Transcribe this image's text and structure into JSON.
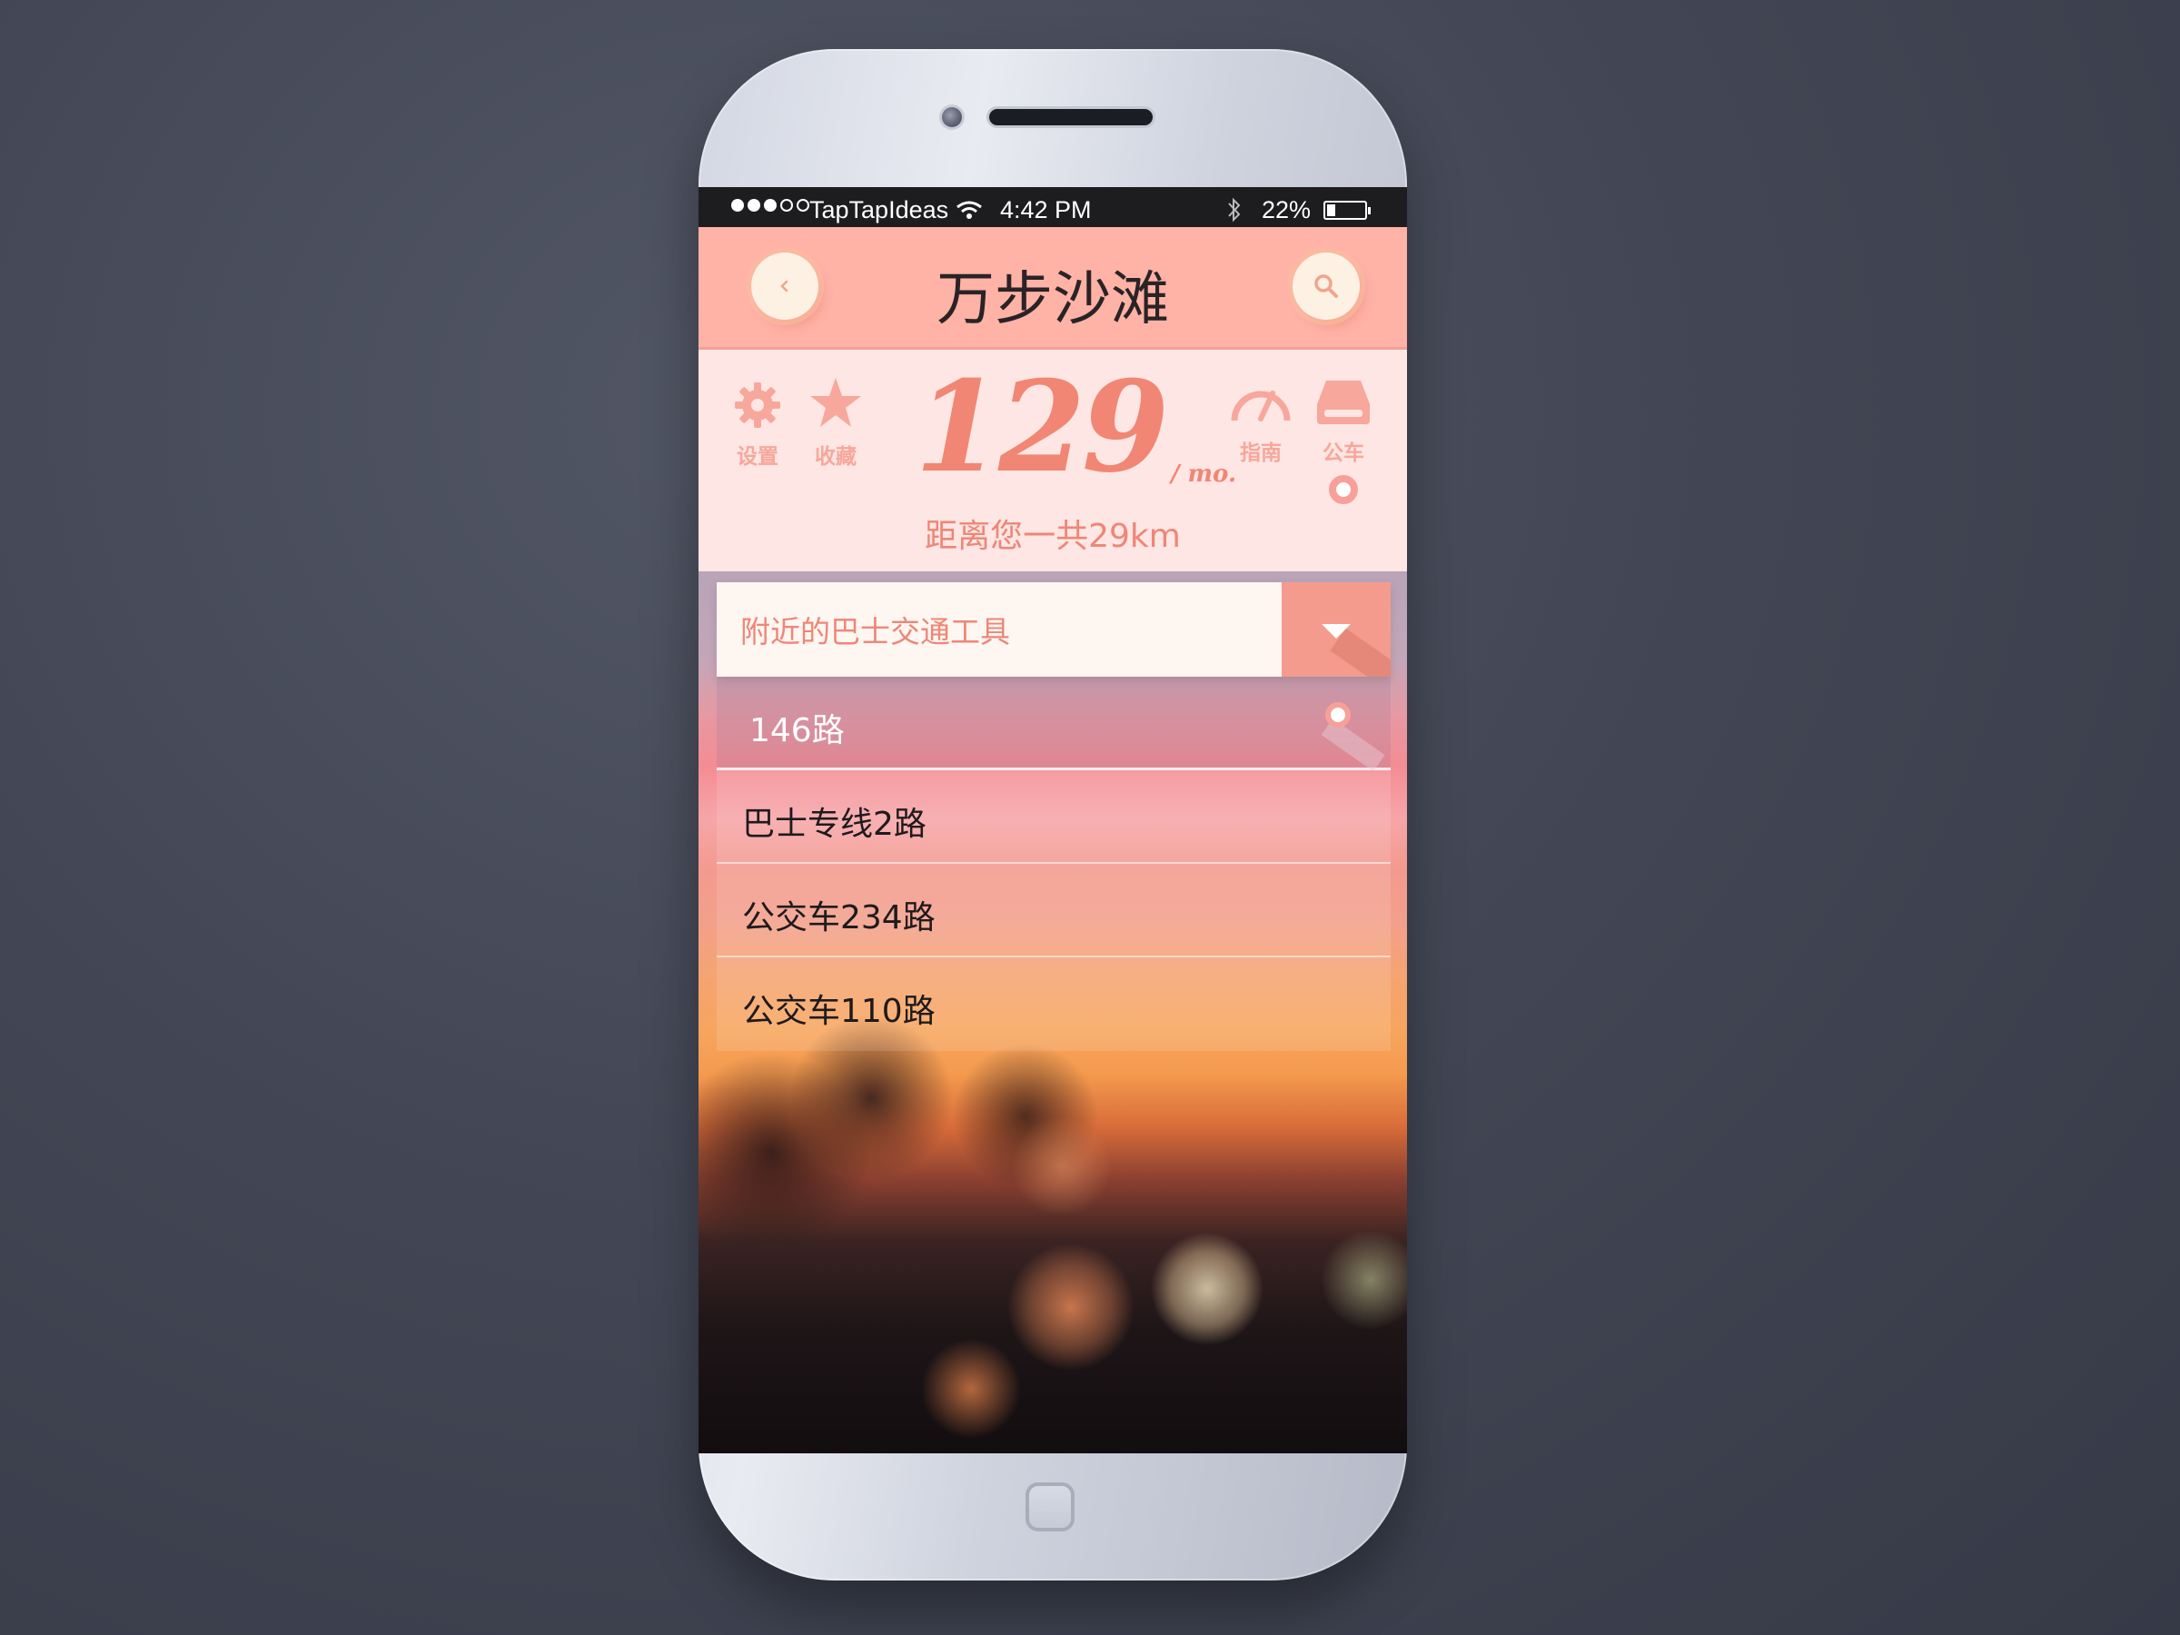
{
  "status_bar": {
    "carrier": "TapTapIdeas",
    "time": "4:42 PM",
    "battery": "22%",
    "signal_bars_filled": 3,
    "signal_bars_total": 5,
    "battery_level": 0.22
  },
  "nav": {
    "title": "万步沙滩",
    "back_icon": "chevron-left-icon",
    "search_icon": "search-icon"
  },
  "tools": {
    "settings": {
      "label": "设置",
      "icon": "gear-icon"
    },
    "favorites": {
      "label": "收藏",
      "icon": "star-icon"
    },
    "guide": {
      "label": "指南",
      "icon": "speedometer-icon"
    },
    "bus": {
      "label": "公车",
      "icon": "bus-icon"
    }
  },
  "stats": {
    "value": "129",
    "unit": "/ mo.",
    "distance": "距离您一共29km"
  },
  "dropdown": {
    "label": "附近的巴士交通工具",
    "routes": [
      {
        "label": "146路",
        "selected": true
      },
      {
        "label": "巴士专线2路",
        "selected": false
      },
      {
        "label": "公交车234路",
        "selected": false
      },
      {
        "label": "公交车110路",
        "selected": false
      }
    ]
  },
  "colors": {
    "accent": "#ffb2a6",
    "accent_dark": "#f18674",
    "panel": "#fde6e3",
    "status_bar": "#1d1d20"
  }
}
